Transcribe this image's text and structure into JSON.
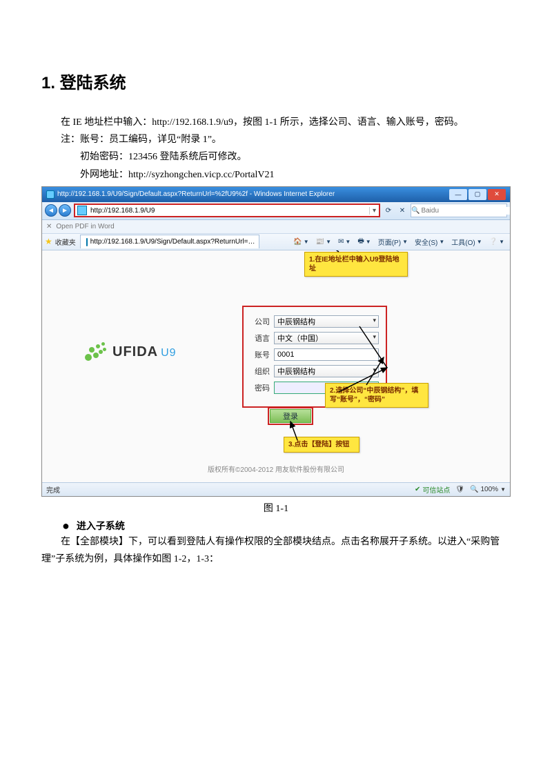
{
  "doc": {
    "heading": "1. 登陆系统",
    "para1": "在 IE 地址栏中输入：http://192.168.1.9/u9，按图 1-1 所示，选择公司、语言、输入账号，密码。",
    "note_line1": "注：账号：员工编码，详见“附录 1”。",
    "note_line2": "初始密码：123456   登陆系统后可修改。",
    "note_line3": "外网地址：http://syzhongchen.vicp.cc/PortalV21",
    "figure_caption": "图 1-1",
    "bullet_title": "进入子系统",
    "para2": "在【全部模块】下，可以看到登陆人有操作权限的全部模块结点。点击名称展开子系统。以进入“采购管理”子系统为例，具体操作如图 1-2，1-3："
  },
  "ie": {
    "title": "http://192.168.1.9/U9/Sign/Default.aspx?ReturnUrl=%2fU9%2f - Windows Internet Explorer",
    "address": "http://192.168.1.9/U9",
    "search_placeholder": "Baidu",
    "row2_text": "Open PDF in Word",
    "fav_label": "收藏夹",
    "tab_text": "http://192.168.1.9/U9/Sign/Default.aspx?ReturnUrl=…",
    "toolbar": {
      "home": "",
      "page": "页面(P)",
      "safety": "安全(S)",
      "tools": "工具(O)"
    },
    "status_done": "完成",
    "status_trust": "可信站点",
    "status_zoom": "100%"
  },
  "login": {
    "logo_text": "UFIDA",
    "logo_sub": "U9",
    "labels": {
      "company": "公司",
      "language": "语言",
      "account": "账号",
      "org": "组织",
      "password": "密码"
    },
    "values": {
      "company": "中辰钢结构",
      "language": "中文（中国）",
      "account": "0001",
      "org": "中辰钢结构",
      "password": ""
    },
    "login_btn": "登录",
    "copyright": "版权所有©2004-2012 用友软件股份有限公司"
  },
  "callouts": {
    "c1": "1.在IE地址栏中输入U9登陆地址",
    "c2": "2.选择公司“中辰钢结构”，填写“账号”，“密码”",
    "c3": "3.点击【登陆】按钮"
  }
}
